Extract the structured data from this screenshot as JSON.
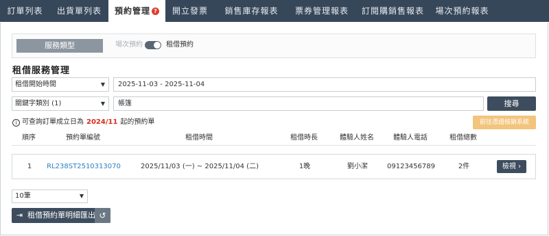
{
  "tabs": [
    {
      "label": "訂單列表"
    },
    {
      "label": "出貨單列表"
    },
    {
      "label": "預約管理",
      "badge": "?"
    },
    {
      "label": "開立發票"
    },
    {
      "label": "銷售庫存報表"
    },
    {
      "label": "票券管理報表"
    },
    {
      "label": "訂閱購銷售報表"
    },
    {
      "label": "場次預約報表"
    }
  ],
  "service": {
    "label": "服務類型",
    "option_off": "場次預約",
    "option_on": "租借預約",
    "toggle_on": true
  },
  "section_title": "租借服務管理",
  "filters": {
    "date_type": "租借開始時間",
    "date_range": "2025-11-03 - 2025-11-04",
    "keyword_type": "關鍵字類別 (1)",
    "keyword": "帳篷",
    "search_label": "搜尋"
  },
  "note": {
    "icon": "i",
    "prefix": "可查詢訂單成立日為",
    "month": "2024/11",
    "suffix": "起的預約單"
  },
  "verify_button": "前往憑證核銷系統",
  "table": {
    "headers": [
      "順序",
      "預約單編號",
      "租借時間",
      "租借時長",
      "體驗人姓名",
      "體驗人電話",
      "租借總數"
    ],
    "rows": [
      {
        "index": "1",
        "order_no": "RL238ST2510313070",
        "period": "2025/11/03 (一) ~ 2025/11/04 (二)",
        "duration": "1晚",
        "name": "劉小潔",
        "phone": "09123456789",
        "total": "2件",
        "action": "檢視 ›"
      }
    ]
  },
  "page_size": "10筆",
  "export_label": "租借預約單明細匯出",
  "colors": {
    "tabbar": "#37475a",
    "primary_button": "#3d4d5e",
    "link": "#2b7fc3",
    "highlight": "#d92b1e",
    "verify": "#f3c47e"
  }
}
